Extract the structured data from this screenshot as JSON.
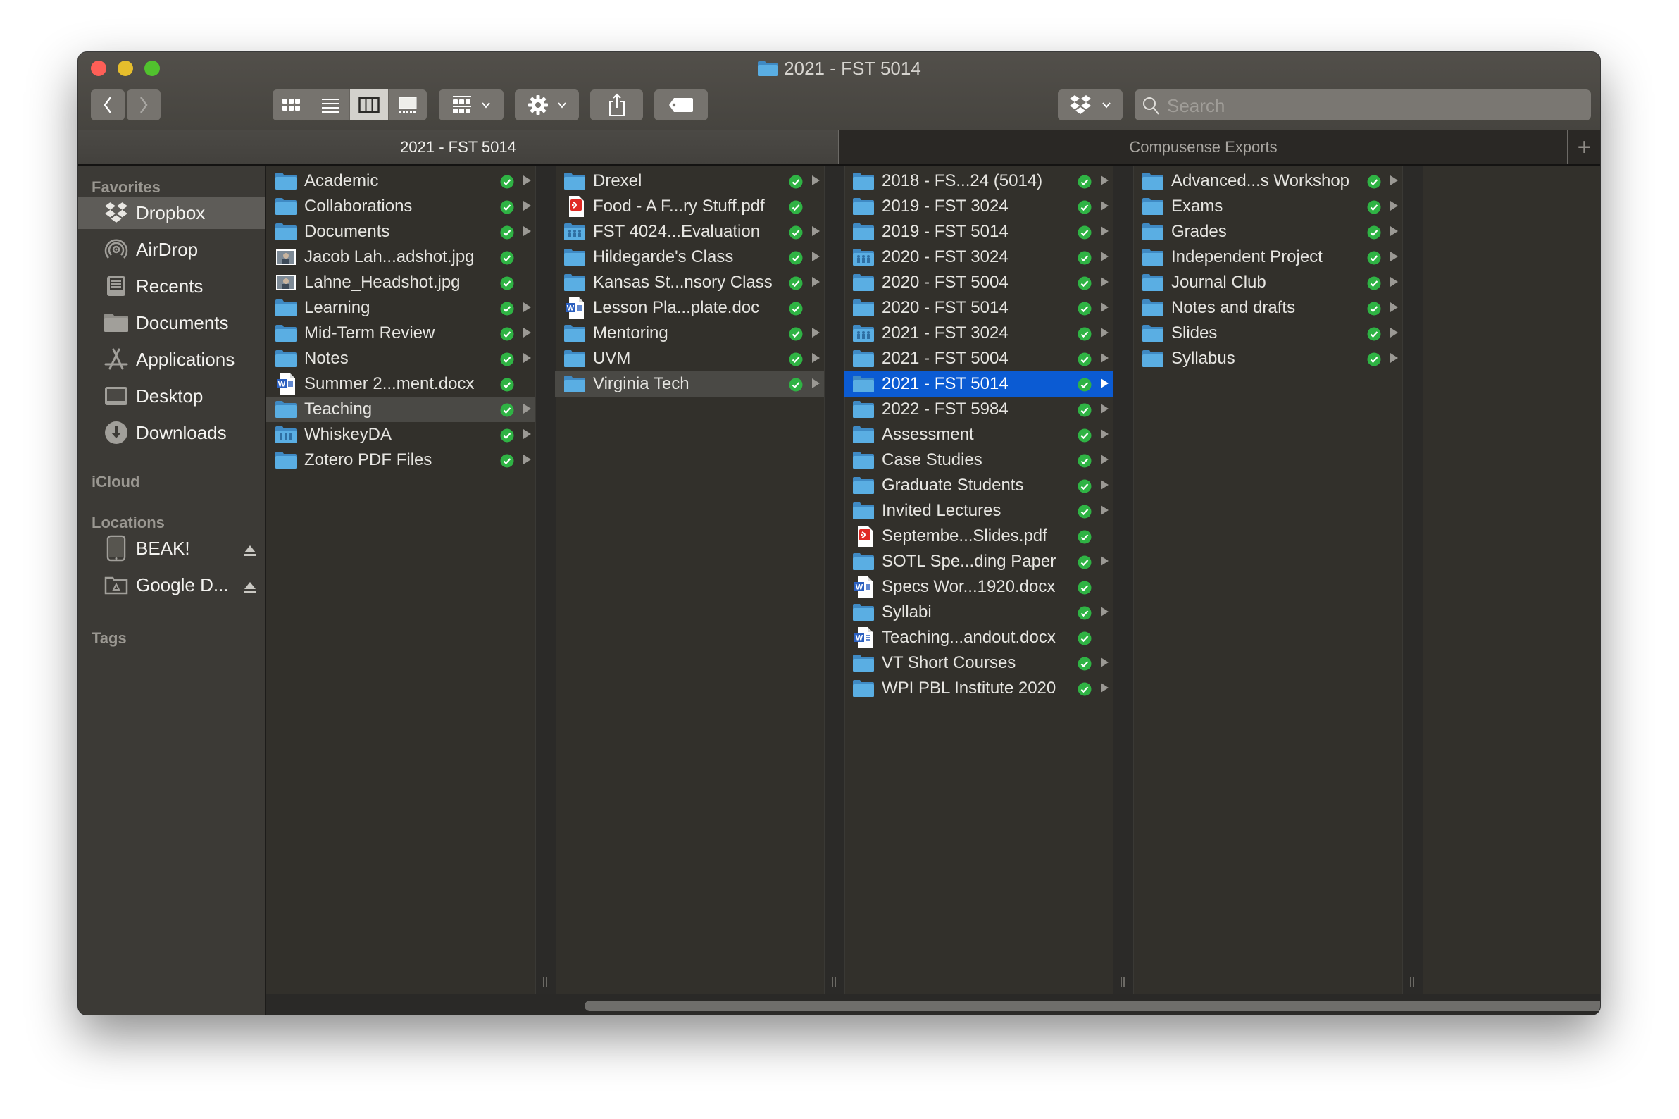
{
  "window": {
    "title": "2021 - FST 5014"
  },
  "toolbar": {
    "back_icon": "chevron-left-icon",
    "forward_icon": "chevron-right-icon",
    "view_modes": [
      {
        "name": "icon-view",
        "icon": "grid-icon",
        "active": false
      },
      {
        "name": "list-view",
        "icon": "list-icon",
        "active": false
      },
      {
        "name": "column-view",
        "icon": "columns-icon",
        "active": true
      },
      {
        "name": "gallery-view",
        "icon": "gallery-icon",
        "active": false
      }
    ],
    "group_icon": "group-icon",
    "action_icon": "gear-icon",
    "share_icon": "share-icon",
    "tag_icon": "tag-icon",
    "dropbox_icon": "dropbox-icon",
    "search_placeholder": "Search"
  },
  "tabs": [
    {
      "label": "2021 - FST 5014",
      "active": true
    },
    {
      "label": "Compusense Exports",
      "active": false
    }
  ],
  "sidebar": {
    "sections": {
      "favorites": "Favorites",
      "icloud": "iCloud",
      "locations": "Locations",
      "tags": "Tags"
    },
    "favorites": [
      {
        "label": "Dropbox",
        "icon": "dropbox-icon",
        "selected": true
      },
      {
        "label": "AirDrop",
        "icon": "airdrop-icon"
      },
      {
        "label": "Recents",
        "icon": "recents-icon"
      },
      {
        "label": "Documents",
        "icon": "folder-icon"
      },
      {
        "label": "Applications",
        "icon": "applications-icon"
      },
      {
        "label": "Desktop",
        "icon": "desktop-icon"
      },
      {
        "label": "Downloads",
        "icon": "downloads-icon"
      }
    ],
    "locations": [
      {
        "label": "BEAK!",
        "icon": "ipad-icon",
        "ejectable": true
      },
      {
        "label": "Google D...",
        "icon": "google-drive-folder-icon",
        "ejectable": true
      }
    ]
  },
  "columns": [
    {
      "items": [
        {
          "name": "Academic",
          "type": "folder",
          "synced": true,
          "has_children": true
        },
        {
          "name": "Collaborations",
          "type": "folder",
          "synced": true,
          "has_children": true
        },
        {
          "name": "Documents",
          "type": "folder",
          "synced": true,
          "has_children": true
        },
        {
          "name": "Jacob Lah...adshot.jpg",
          "type": "image",
          "synced": true,
          "has_children": false
        },
        {
          "name": "Lahne_Headshot.jpg",
          "type": "image",
          "synced": true,
          "has_children": false
        },
        {
          "name": "Learning",
          "type": "folder",
          "synced": true,
          "has_children": true
        },
        {
          "name": "Mid-Term Review",
          "type": "folder",
          "synced": true,
          "has_children": true
        },
        {
          "name": "Notes",
          "type": "folder",
          "synced": true,
          "has_children": true
        },
        {
          "name": "Summer 2...ment.docx",
          "type": "word",
          "synced": true,
          "has_children": false
        },
        {
          "name": "Teaching",
          "type": "folder",
          "synced": true,
          "has_children": true,
          "selected": "path"
        },
        {
          "name": "WhiskeyDA",
          "type": "shared-folder",
          "synced": true,
          "has_children": true
        },
        {
          "name": "Zotero PDF Files",
          "type": "folder",
          "synced": true,
          "has_children": true
        }
      ]
    },
    {
      "items": [
        {
          "name": "Drexel",
          "type": "folder",
          "synced": true,
          "has_children": true
        },
        {
          "name": "Food - A F...ry Stuff.pdf",
          "type": "pdf",
          "synced": true,
          "has_children": false
        },
        {
          "name": "FST 4024...Evaluation",
          "type": "shared-folder",
          "synced": true,
          "has_children": true
        },
        {
          "name": "Hildegarde's Class",
          "type": "folder",
          "synced": true,
          "has_children": true
        },
        {
          "name": "Kansas St...nsory Class",
          "type": "folder",
          "synced": true,
          "has_children": true
        },
        {
          "name": "Lesson Pla...plate.doc",
          "type": "word",
          "synced": true,
          "has_children": false
        },
        {
          "name": "Mentoring",
          "type": "folder",
          "synced": true,
          "has_children": true
        },
        {
          "name": "UVM",
          "type": "folder",
          "synced": true,
          "has_children": true
        },
        {
          "name": "Virginia Tech",
          "type": "folder",
          "synced": true,
          "has_children": true,
          "selected": "path"
        }
      ]
    },
    {
      "items": [
        {
          "name": "2018 - FS...24 (5014)",
          "type": "folder",
          "synced": true,
          "has_children": true
        },
        {
          "name": "2019 - FST 3024",
          "type": "folder",
          "synced": true,
          "has_children": true
        },
        {
          "name": "2019 - FST 5014",
          "type": "folder",
          "synced": true,
          "has_children": true
        },
        {
          "name": "2020 - FST 3024",
          "type": "shared-folder",
          "synced": true,
          "has_children": true
        },
        {
          "name": "2020 - FST 5004",
          "type": "folder",
          "synced": true,
          "has_children": true
        },
        {
          "name": "2020 - FST 5014",
          "type": "folder",
          "synced": true,
          "has_children": true
        },
        {
          "name": "2021 - FST 3024",
          "type": "shared-folder",
          "synced": true,
          "has_children": true
        },
        {
          "name": "2021 - FST 5004",
          "type": "folder",
          "synced": true,
          "has_children": true
        },
        {
          "name": "2021 - FST 5014",
          "type": "folder",
          "synced": true,
          "has_children": true,
          "selected": "active"
        },
        {
          "name": "2022 - FST 5984",
          "type": "folder",
          "synced": true,
          "has_children": true
        },
        {
          "name": "Assessment",
          "type": "folder",
          "synced": true,
          "has_children": true
        },
        {
          "name": "Case Studies",
          "type": "folder",
          "synced": true,
          "has_children": true
        },
        {
          "name": "Graduate Students",
          "type": "folder",
          "synced": true,
          "has_children": true
        },
        {
          "name": "Invited Lectures",
          "type": "folder",
          "synced": true,
          "has_children": true
        },
        {
          "name": "Septembe...Slides.pdf",
          "type": "pdf",
          "synced": true,
          "has_children": false
        },
        {
          "name": "SOTL Spe...ding Paper",
          "type": "folder",
          "synced": true,
          "has_children": true
        },
        {
          "name": "Specs Wor...1920.docx",
          "type": "word",
          "synced": true,
          "has_children": false
        },
        {
          "name": "Syllabi",
          "type": "folder",
          "synced": true,
          "has_children": true
        },
        {
          "name": "Teaching...andout.docx",
          "type": "word",
          "synced": true,
          "has_children": false
        },
        {
          "name": "VT Short Courses",
          "type": "folder",
          "synced": true,
          "has_children": true
        },
        {
          "name": "WPI PBL Institute 2020",
          "type": "folder",
          "synced": true,
          "has_children": true
        }
      ]
    },
    {
      "items": [
        {
          "name": "Advanced...s Workshop",
          "type": "folder",
          "synced": true,
          "has_children": true
        },
        {
          "name": "Exams",
          "type": "folder",
          "synced": true,
          "has_children": true
        },
        {
          "name": "Grades",
          "type": "folder",
          "synced": true,
          "has_children": true
        },
        {
          "name": "Independent Project",
          "type": "folder",
          "synced": true,
          "has_children": true
        },
        {
          "name": "Journal Club",
          "type": "folder",
          "synced": true,
          "has_children": true
        },
        {
          "name": "Notes and drafts",
          "type": "folder",
          "synced": true,
          "has_children": true
        },
        {
          "name": "Slides",
          "type": "folder",
          "synced": true,
          "has_children": true
        },
        {
          "name": "Syllabus",
          "type": "folder",
          "synced": true,
          "has_children": true
        }
      ]
    }
  ],
  "colors": {
    "selection_active": "#0b5bd3",
    "selection_path": "#4a4945",
    "folder_blue": "#5aaee3",
    "sync_green": "#2fb344"
  }
}
